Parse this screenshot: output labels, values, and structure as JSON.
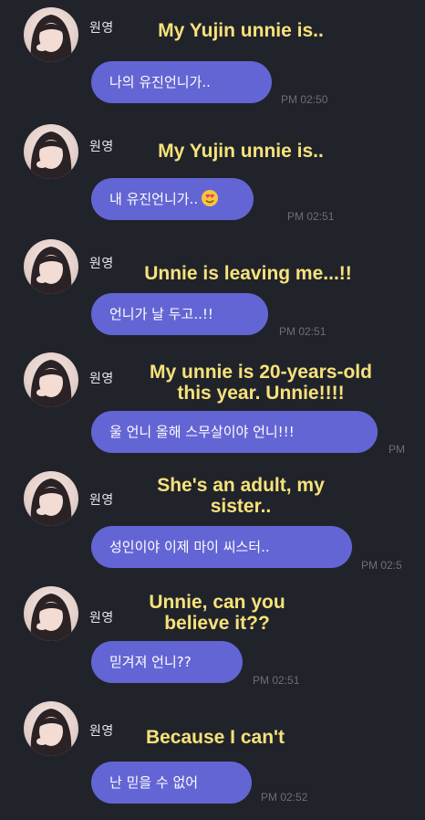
{
  "sender_name": "원영",
  "messages": [
    {
      "caption": "My Yujin unnie is..",
      "text": "나의 유진언니가..",
      "time": "PM 02:50"
    },
    {
      "caption": "My Yujin unnie is..",
      "text": "내 유진언니가..",
      "emoji": "smiling-face-with-heart-eyes",
      "time": "PM 02:51"
    },
    {
      "caption": "Unnie is leaving me...!!",
      "text": "언니가 날 두고..!!",
      "time": "PM 02:51"
    },
    {
      "caption_lines": [
        "My unnie is 20-years-old",
        "this year. Unnie!!!!"
      ],
      "text": "울 언니 올해 스무살이야 언니!!!",
      "time": "PM"
    },
    {
      "caption_lines": [
        "She's an adult, my",
        "sister.."
      ],
      "text": "성인이야 이제 마이 씨스터..",
      "time": "PM 02:5"
    },
    {
      "caption_lines": [
        "Unnie, can you",
        "believe it??"
      ],
      "text": "믿겨져 언니??",
      "time": "PM 02:51"
    },
    {
      "caption": "Because I can't",
      "text": "난 믿을 수 없어",
      "time": "PM 02:52"
    }
  ],
  "colors": {
    "background": "#21232b",
    "bubble": "#6465d4",
    "caption": "#f7e27a",
    "timestamp": "#6c6e78"
  }
}
